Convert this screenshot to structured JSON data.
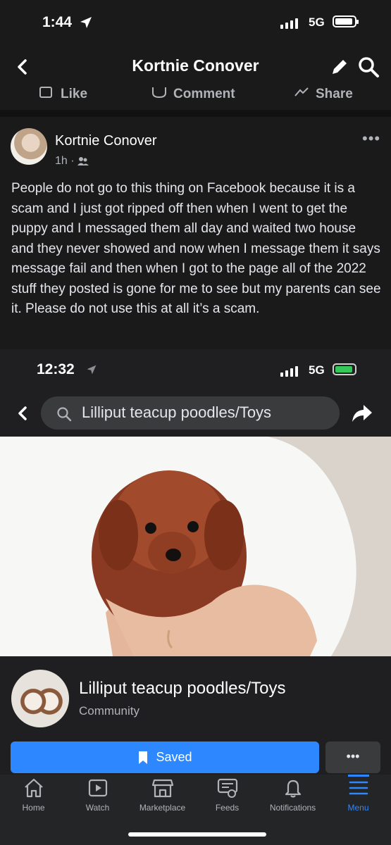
{
  "status_bar": {
    "time": "1:44",
    "network": "5G"
  },
  "header": {
    "title": "Kortnie Conover"
  },
  "actions": {
    "like": "Like",
    "comment": "Comment",
    "share": "Share"
  },
  "post": {
    "author": "Kortnie Conover",
    "time": "1h ·",
    "text": "People do not go to this thing on Facebook because it is a scam and I just got ripped off then when I went to get the puppy and I messaged them all day and waited two house and they never showed and now when I message them it says message fail and then when I got to the page all of the 2022 stuff they posted is gone for me to see but my parents can see it. Please do not use this at all it’s a scam."
  },
  "embedded": {
    "status_time": "12:32",
    "network": "5G",
    "search_text": "Lilliput teacup poodles/Toys",
    "page_name": "Lilliput teacup poodles/Toys",
    "page_type": "Community",
    "saved_label": "Saved",
    "more_label": "•••"
  },
  "tabs": [
    {
      "label": "Home",
      "icon": "home-icon"
    },
    {
      "label": "Watch",
      "icon": "watch-icon"
    },
    {
      "label": "Marketplace",
      "icon": "marketplace-icon"
    },
    {
      "label": "Feeds",
      "icon": "feeds-icon"
    },
    {
      "label": "Notifications",
      "icon": "bell-icon"
    },
    {
      "label": "Menu",
      "icon": "menu-icon",
      "active": true
    }
  ],
  "colors": {
    "accent": "#2d88ff",
    "background": "#1a1a1b",
    "battery_charging": "#34c759"
  }
}
